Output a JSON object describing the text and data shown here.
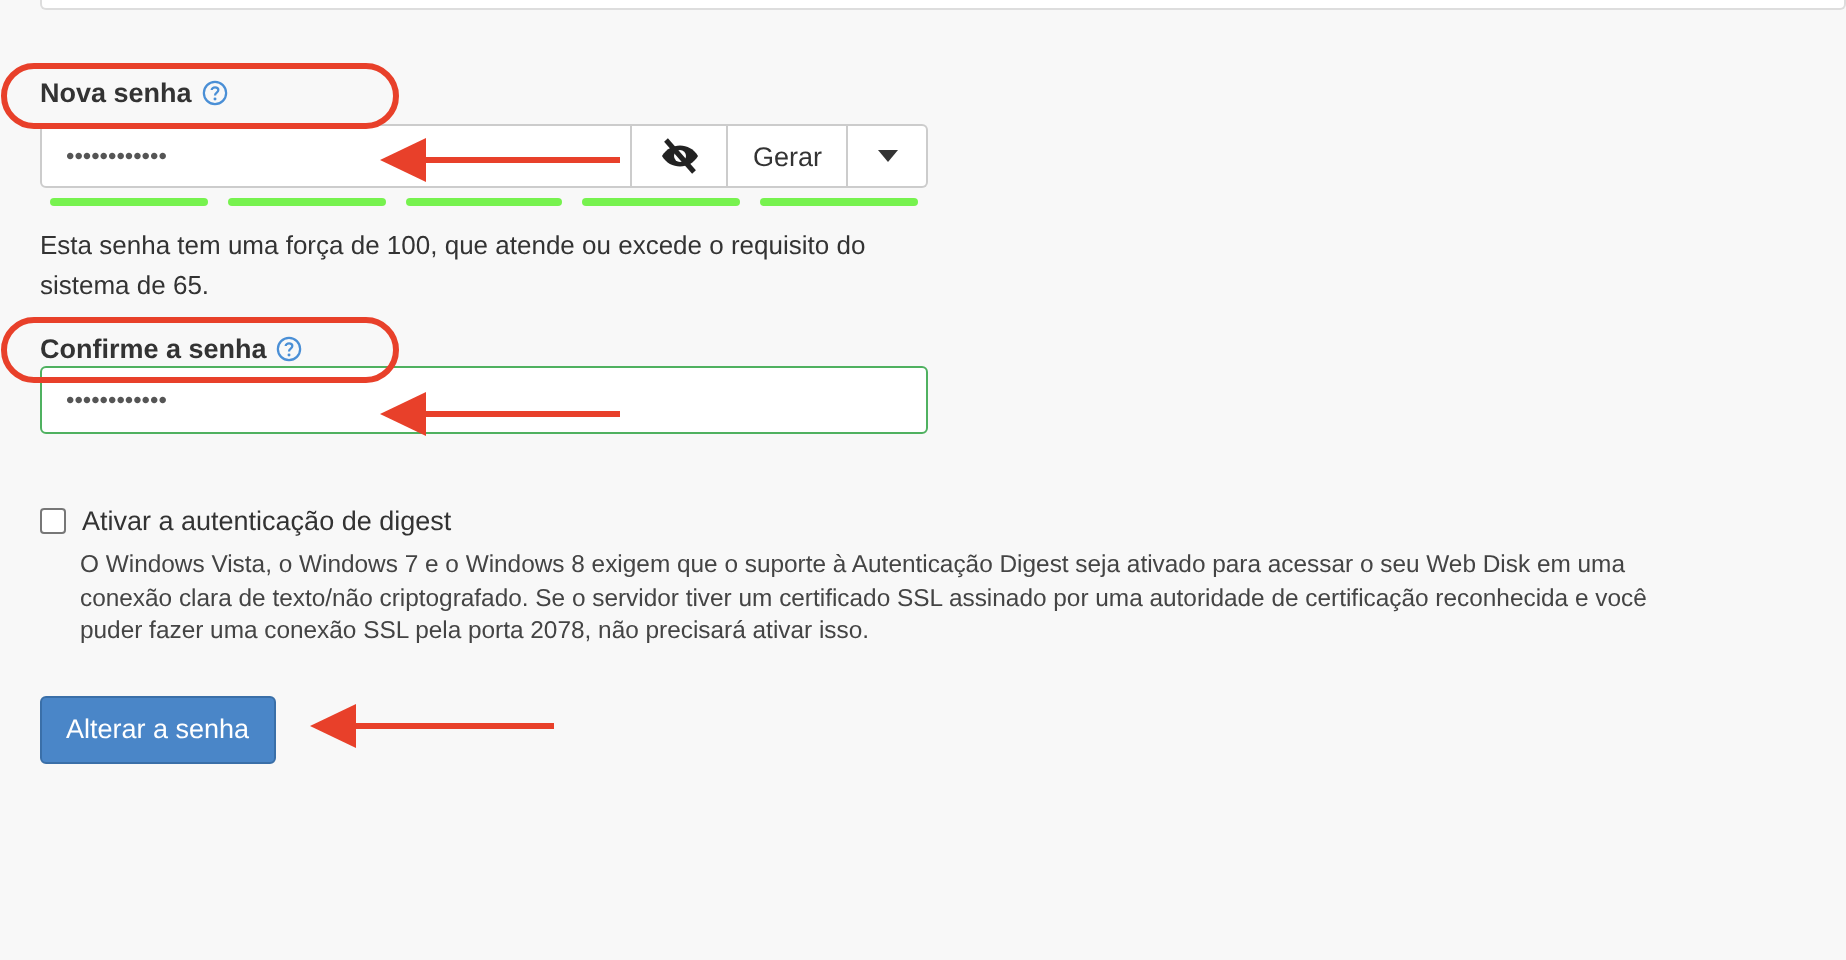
{
  "new_password": {
    "label": "Nova senha",
    "value": "••••••••••••",
    "visible": false,
    "generate_button": "Gerar",
    "strength": {
      "segments": [
        {
          "filled": true
        },
        {
          "filled": true
        },
        {
          "filled": true
        },
        {
          "filled": true
        },
        {
          "filled": true
        }
      ]
    },
    "strength_note": "Esta senha tem uma força de 100, que atende ou excede o requisito do sistema de 65."
  },
  "confirm_password": {
    "label": "Confirme a senha",
    "value": "••••••••••••",
    "valid": true
  },
  "digest": {
    "label": "Ativar a autenticação de digest",
    "checked": false,
    "description": "O Windows Vista, o Windows 7 e o Windows 8 exigem que o suporte à Autenticação Digest seja ativado para acessar o seu Web Disk em uma conexão clara de texto/não criptografado. Se o servidor tiver um certificado SSL assinado por uma autoridade de certificação reconhecida e você puder fazer uma conexão SSL pela porta 2078, não precisará ativar isso."
  },
  "submit_button": "Alterar a senha"
}
